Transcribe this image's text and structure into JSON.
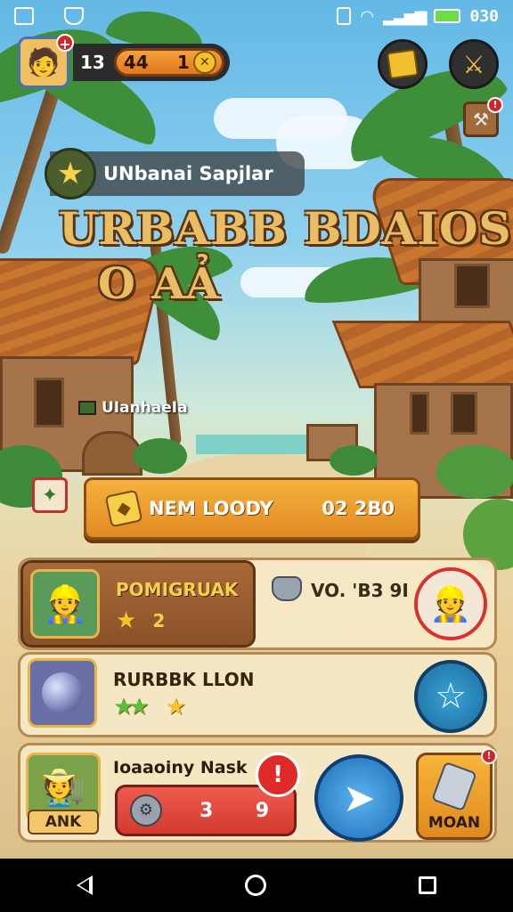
{
  "status_bar": {
    "time": "030",
    "left_icons": [
      "gallery-icon",
      "shield-icon"
    ],
    "right_icons": [
      "info-icon",
      "wifi-icon",
      "signal-icon",
      "battery-icon"
    ]
  },
  "hud": {
    "level": "13",
    "xp_value": "44",
    "coins": "1",
    "add_badge": "+",
    "icons": [
      "gold-chest-icon",
      "sword-icon",
      "hammer-icon"
    ]
  },
  "quest_banner": {
    "text": "UNbanai Sapjlar"
  },
  "title": {
    "line1": "URBABB BDAIOS",
    "line2": "O AẢ"
  },
  "signpost": {
    "text": "UIanhaeIa"
  },
  "loot_panel": {
    "label": "NEM LOODY",
    "value": "02 2B0"
  },
  "rows": [
    {
      "card_title": "POMIGRUAK",
      "stars": 1,
      "level": "2",
      "value": "VO. 'B3 9I"
    },
    {
      "card_title": "RURBBK LLON",
      "stars_green": 2,
      "stars": 1
    },
    {
      "quest_label": "Ioaaoiny Nask",
      "progress_left": "3",
      "progress_right": "9",
      "badge_label": "ANK",
      "action_label": "MOAN"
    }
  ],
  "colors": {
    "accent_orange": "#f6b13e",
    "accent_red": "#d23a30",
    "accent_blue": "#1f6db8",
    "title_gold": "#e9bd66"
  }
}
